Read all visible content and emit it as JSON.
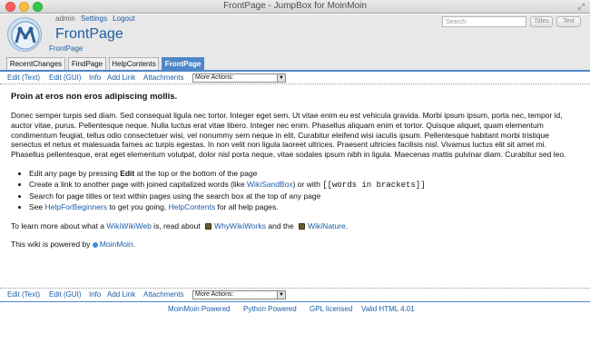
{
  "window": {
    "title": "FrontPage - JumpBox for MoinMoin"
  },
  "user": {
    "name": "admin",
    "settings": "Settings",
    "logout": "Logout"
  },
  "site": {
    "name": "FrontPage",
    "page_link": "FrontPage"
  },
  "search": {
    "placeholder": "Search",
    "titles_label": "Titles",
    "text_label": "Text"
  },
  "tabs": [
    {
      "label": "RecentChanges",
      "active": false
    },
    {
      "label": "FindPage",
      "active": false
    },
    {
      "label": "HelpContents",
      "active": false
    },
    {
      "label": "FrontPage",
      "active": true
    }
  ],
  "actions": {
    "edit_text": "Edit (Text)",
    "edit_gui": "Edit (GUI)",
    "info": "Info",
    "add_link": "Add Link",
    "attachments": "Attachments",
    "more_actions": "More Actions:"
  },
  "content": {
    "heading": "Proin at eros non eros adipiscing mollis.",
    "lorem": "Donec semper turpis sed diam. Sed consequat ligula nec tortor. Integer eget sem. Ut vitae enim eu est vehicula gravida. Morbi ipsum ipsum, porta nec, tempor id, auctor vitae, purus. Pellentesque neque. Nulla luctus erat vitae libero. Integer nec enim. Phasellus aliquam enim et tortor. Quisque aliquet, quam elementum condimentum feugiat, tellus odio consectetuer wisi, vel nonummy sem neque in elit. Curabitur eleifend wisi iaculis ipsum. Pellentesque habitant morbi tristique senectus et netus et malesuada fames ac turpis egestas. In non velit non ligula laoreet ultrices. Praesent ultricies facilisis nisl. Vivamus luctus elit sit amet mi. Phasellus pellentesque, erat eget elementum volutpat, dolor nisl porta neque, vitae sodales ipsum nibh in ligula. Maecenas mattis pulvinar diam. Curabitur sed leo.",
    "bullets": {
      "b1_pre": "Edit any page by pressing ",
      "b1_bold": "Edit",
      "b1_post": " at the top or the bottom of the page",
      "b2_pre": "Create a link to another page with joined capitalized words (like ",
      "b2_link": "WikiSandBox",
      "b2_mid": ") or with ",
      "b2_code": "[[words in brackets]]",
      "b3": "Search for page titles or text within pages using the search box at the top of any page",
      "b4_pre": "See ",
      "b4_link1": "HelpForBeginners",
      "b4_mid": " to get you going, ",
      "b4_link2": "HelpContents",
      "b4_post": " for all help pages."
    },
    "learn": {
      "pre": "To learn more about what a ",
      "link1": "WikiWikiWeb",
      "mid1": " is, read about ",
      "link2": "WhyWikiWorks",
      "mid2": " and the ",
      "link3": "WikiNature",
      "post": "."
    },
    "powered": {
      "pre": "This wiki is powered by ",
      "link": "MoinMoin",
      "post": "."
    }
  },
  "footer": {
    "moinmoin": "MoinMoin Powered",
    "python": "Python Powered",
    "gpl": "GPL licensed",
    "html": "Valid HTML 4.01"
  },
  "colors": {
    "accent": "#4f86c8",
    "link": "#1a5ea8"
  }
}
